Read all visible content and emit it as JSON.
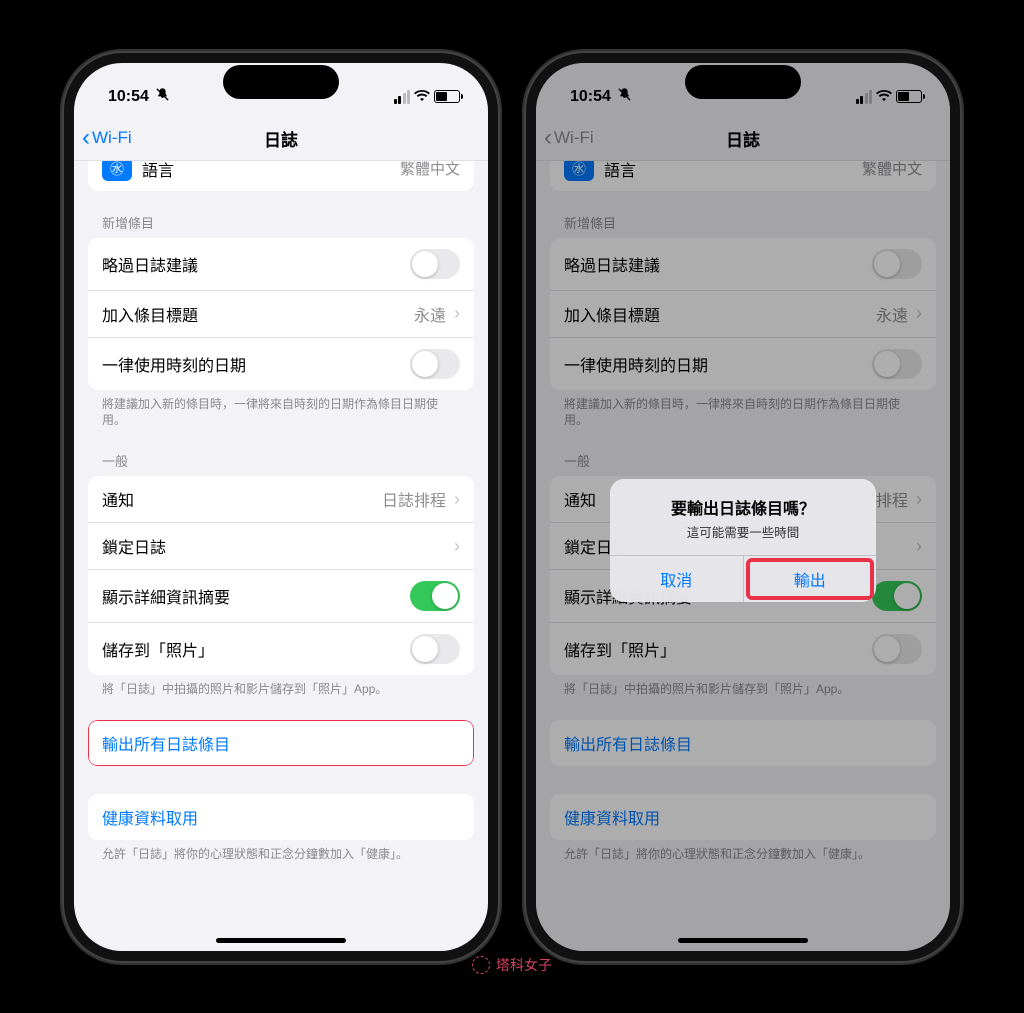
{
  "status": {
    "time": "10:54"
  },
  "nav": {
    "back": "Wi-Fi",
    "title": "日誌"
  },
  "cutRow": {
    "label": "語言",
    "value": "繁體中文"
  },
  "section1": {
    "header": "新增條目",
    "row1": "略過日誌建議",
    "row2": {
      "label": "加入條目標題",
      "value": "永遠"
    },
    "row3": "一律使用時刻的日期",
    "footer": "將建議加入新的條目時，一律將來自時刻的日期作為條目日期使用。"
  },
  "section2": {
    "header": "一般",
    "row1": {
      "label": "通知",
      "value": "日誌排程"
    },
    "row2": "鎖定日誌",
    "row3": "顯示詳細資訊摘要",
    "row4": "儲存到「照片」",
    "footer": "將「日誌」中拍攝的照片和影片儲存到「照片」App。"
  },
  "export": "輸出所有日誌條目",
  "health": {
    "label": "健康資料取用",
    "footer": "允許「日誌」將你的心理狀態和正念分鐘數加入「健康」。"
  },
  "alert": {
    "title": "要輸出日誌條目嗎？",
    "msg": "這可能需要一些時間",
    "cancel": "取消",
    "confirm": "輸出"
  },
  "watermark": "塔科女子"
}
